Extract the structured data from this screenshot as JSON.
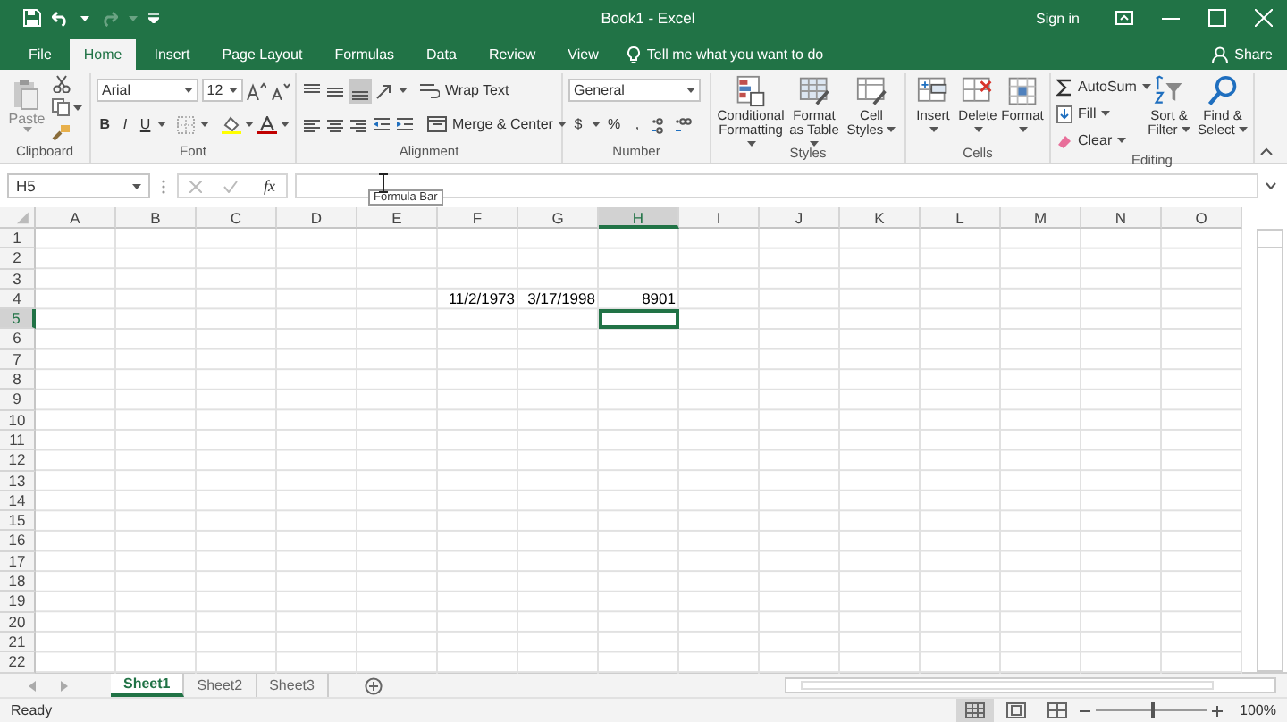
{
  "window": {
    "title": "Book1  -  Excel",
    "sign_in": "Sign in"
  },
  "tabs": [
    {
      "label": "File",
      "selected": false
    },
    {
      "label": "Home",
      "selected": true
    },
    {
      "label": "Insert",
      "selected": false
    },
    {
      "label": "Page Layout",
      "selected": false
    },
    {
      "label": "Formulas",
      "selected": false
    },
    {
      "label": "Data",
      "selected": false
    },
    {
      "label": "Review",
      "selected": false
    },
    {
      "label": "View",
      "selected": false
    }
  ],
  "tell_me": {
    "placeholder": "Tell me what you want to do"
  },
  "share": "Share",
  "ribbon": {
    "groups": [
      {
        "kind": "clipboard",
        "label": "Clipboard",
        "buttons": [
          "Paste"
        ]
      },
      {
        "kind": "font",
        "label": "Font",
        "font_name": "Arial",
        "font_size": "12",
        "buttons": [
          "B",
          "I",
          "U"
        ]
      },
      {
        "kind": "alignment",
        "label": "Alignment",
        "buttons": [
          "Wrap Text",
          "Merge & Center"
        ]
      },
      {
        "kind": "number",
        "label": "Number",
        "format": "General",
        "buttons": [
          "$",
          "%",
          ","
        ]
      },
      {
        "kind": "styles",
        "label": "Styles",
        "buttons": [
          "Conditional Formatting",
          "Format as Table",
          "Cell Styles"
        ]
      },
      {
        "kind": "cells",
        "label": "Cells",
        "buttons": [
          "Insert",
          "Delete",
          "Format"
        ]
      },
      {
        "kind": "editing",
        "label": "Editing",
        "buttons": [
          "AutoSum",
          "Fill",
          "Clear",
          "Sort & Filter",
          "Find & Select"
        ]
      }
    ]
  },
  "formula_bar": {
    "name_box": "H5",
    "insert_function": "fx",
    "tooltip": "Formula Bar"
  },
  "sheet": {
    "columns": [
      {
        "label": "A",
        "selected": false
      },
      {
        "label": "B",
        "selected": false
      },
      {
        "label": "C",
        "selected": false
      },
      {
        "label": "D",
        "selected": false
      },
      {
        "label": "E",
        "selected": false
      },
      {
        "label": "F",
        "selected": false
      },
      {
        "label": "G",
        "selected": false
      },
      {
        "label": "H",
        "selected": true
      },
      {
        "label": "I",
        "selected": false
      },
      {
        "label": "J",
        "selected": false
      },
      {
        "label": "K",
        "selected": false
      },
      {
        "label": "L",
        "selected": false
      },
      {
        "label": "M",
        "selected": false
      },
      {
        "label": "N",
        "selected": false
      },
      {
        "label": "O",
        "selected": false
      }
    ],
    "rows": [
      {
        "label": "1",
        "selected": false
      },
      {
        "label": "2",
        "selected": false
      },
      {
        "label": "3",
        "selected": false
      },
      {
        "label": "4",
        "selected": false,
        "cells": {
          "F": {
            "text": "11/2/1973",
            "selected": false
          },
          "G": {
            "text": "3/17/1998",
            "selected": false
          },
          "H": {
            "text": "8901",
            "selected": false
          }
        }
      },
      {
        "label": "5",
        "selected": true,
        "cells": {
          "H": {
            "selected": true
          }
        }
      },
      {
        "label": "6",
        "selected": false
      },
      {
        "label": "7",
        "selected": false
      },
      {
        "label": "8",
        "selected": false
      },
      {
        "label": "9",
        "selected": false
      },
      {
        "label": "10",
        "selected": false
      },
      {
        "label": "11",
        "selected": false
      },
      {
        "label": "12",
        "selected": false
      },
      {
        "label": "13",
        "selected": false
      },
      {
        "label": "14",
        "selected": false
      },
      {
        "label": "15",
        "selected": false
      },
      {
        "label": "16",
        "selected": false
      },
      {
        "label": "17",
        "selected": false
      },
      {
        "label": "18",
        "selected": false
      },
      {
        "label": "19",
        "selected": false
      },
      {
        "label": "20",
        "selected": false
      },
      {
        "label": "21",
        "selected": false
      },
      {
        "label": "22",
        "selected": false
      }
    ]
  },
  "sheet_tabs": [
    {
      "label": "Sheet1",
      "selected": true
    },
    {
      "label": "Sheet2",
      "selected": false
    },
    {
      "label": "Sheet3",
      "selected": false
    }
  ],
  "status_bar": {
    "text": "Ready",
    "views": [
      {
        "selected": true
      },
      {
        "selected": false
      },
      {
        "selected": false
      }
    ],
    "zoom": {
      "level": 0.5,
      "text": "100%"
    }
  }
}
